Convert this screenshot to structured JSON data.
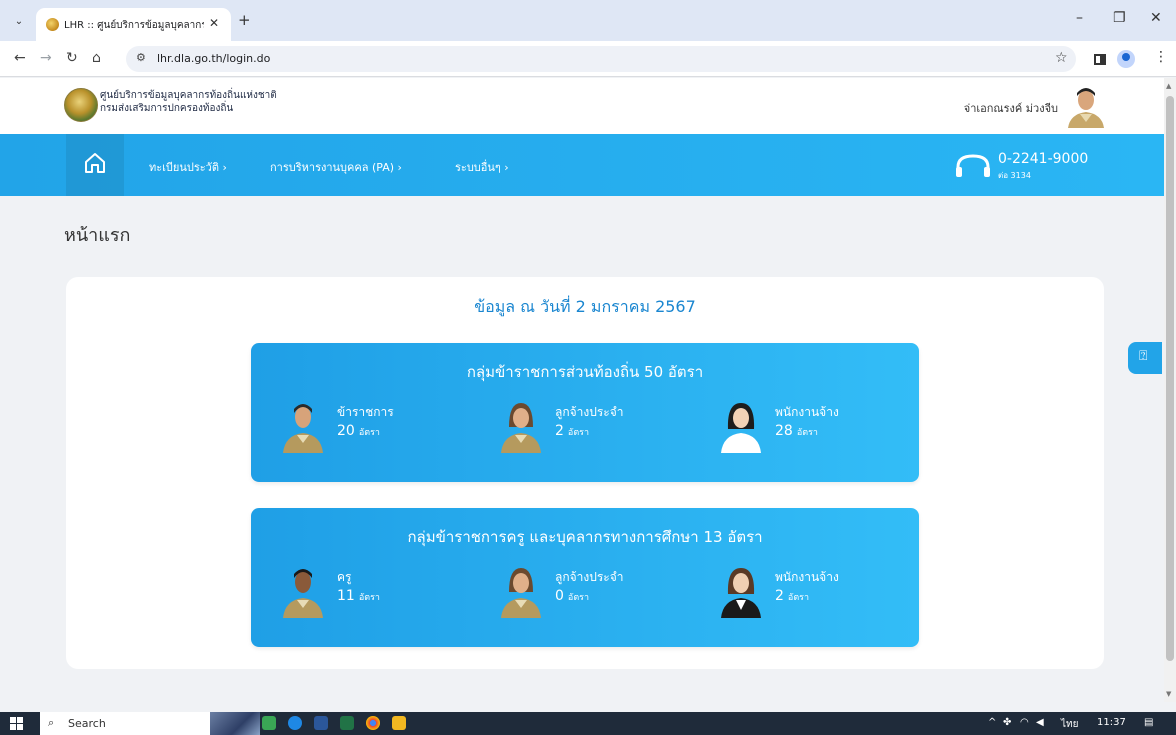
{
  "browser": {
    "tab_title": "LHR :: ศูนย์บริการข้อมูลบุคลากรท้อง",
    "url": "lhr.dla.go.th/login.do",
    "new_tab_label": "+",
    "close_tab": "✕"
  },
  "header": {
    "org_line1": "ศูนย์บริการข้อมูลบุคลากรท้องถิ่นแห่งชาติ",
    "org_line2": "กรมส่งเสริมการปกครองท้องถิ่น",
    "user_name": "จ่าเอกณรงค์ ม่วงจีบ"
  },
  "nav": {
    "items": [
      {
        "label": "ทะเบียนประวัติ ›"
      },
      {
        "label": "การบริหารงานบุคคล (PA) ›"
      },
      {
        "label": "ระบบอื่นๆ ›"
      }
    ],
    "phone": "0-2241-9000",
    "ext": "ต่อ 3134"
  },
  "page": {
    "title": "หน้าแรก",
    "date_line": "ข้อมูล ณ วันที่ 2 มกราคม 2567"
  },
  "groups": [
    {
      "title": "กลุ่มข้าราชการส่วนท้องถิ่น 50 อัตรา",
      "stats": [
        {
          "label": "ข้าราชการ",
          "value": "20",
          "unit": "อัตรา",
          "icon": "officer-icon"
        },
        {
          "label": "ลูกจ้างประจำ",
          "value": "2",
          "unit": "อัตรา",
          "icon": "female-officer-icon"
        },
        {
          "label": "พนักงานจ้าง",
          "value": "28",
          "unit": "อัตรา",
          "icon": "employee-icon"
        }
      ]
    },
    {
      "title": "กลุ่มข้าราชการครู และบุคลากรทางการศึกษา 13 อัตรา",
      "stats": [
        {
          "label": "ครู",
          "value": "11",
          "unit": "อัตรา",
          "icon": "teacher-icon"
        },
        {
          "label": "ลูกจ้างประจำ",
          "value": "0",
          "unit": "อัตรา",
          "icon": "female-officer-icon"
        },
        {
          "label": "พนักงานจ้าง",
          "value": "2",
          "unit": "อัตรา",
          "icon": "employee-icon"
        }
      ]
    }
  ],
  "taskbar": {
    "search_placeholder": "Search",
    "lang": "ไทย",
    "time": "11:37"
  },
  "colors": {
    "nav_blue": "#22a4e8",
    "group_blue": "#33bdf7",
    "date_text": "#1a86d0"
  }
}
